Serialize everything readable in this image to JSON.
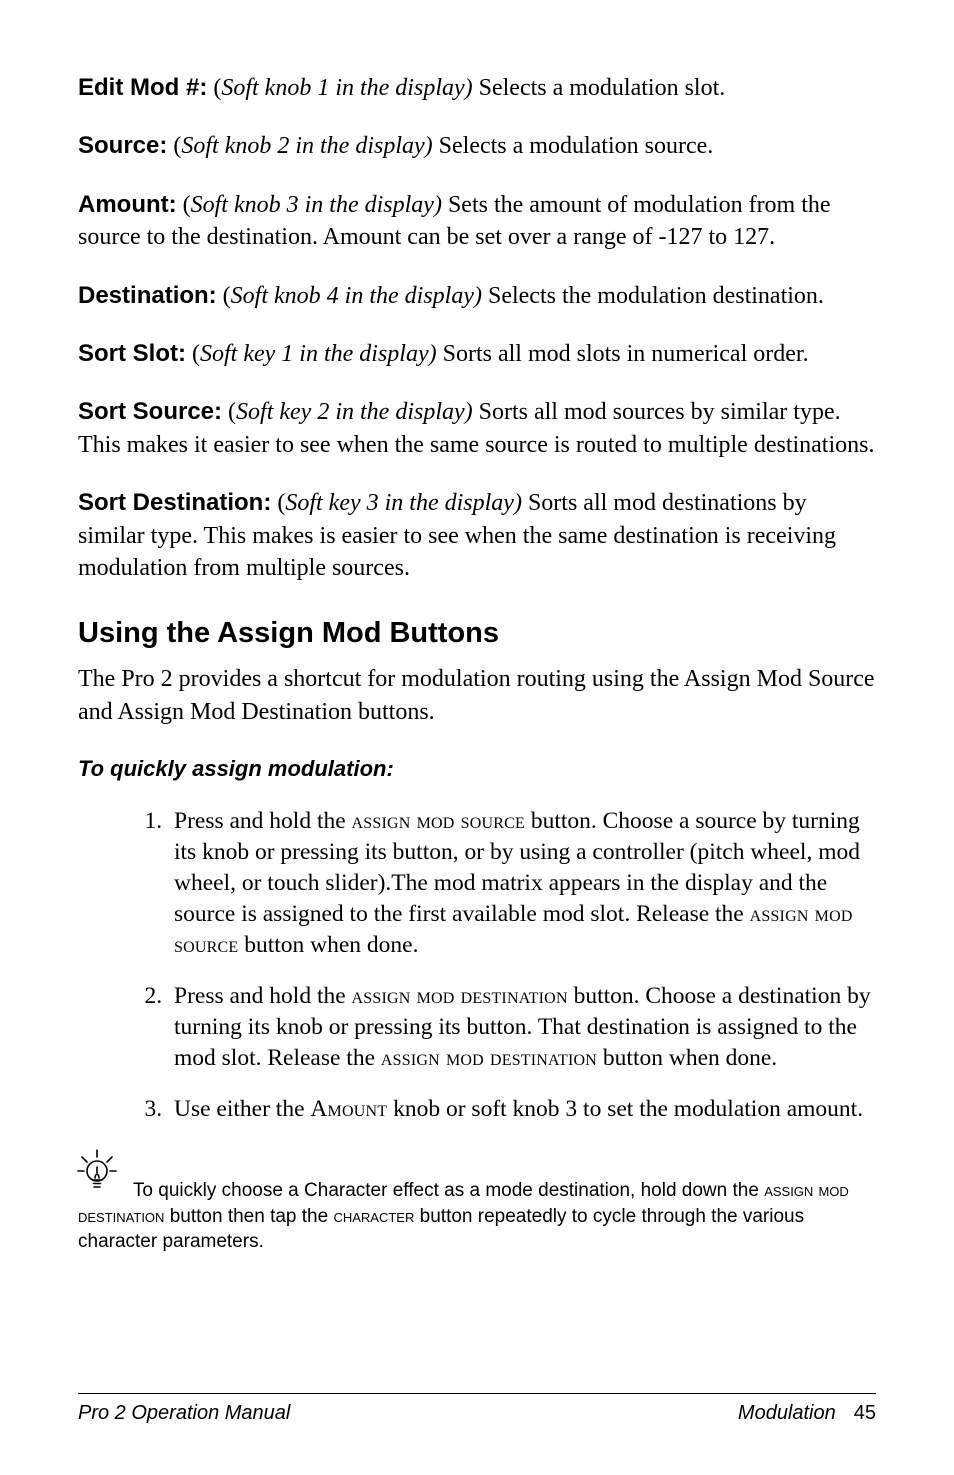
{
  "p1": {
    "label": "Edit Mod #:",
    "hint": "Soft knob 1 in the display)",
    "rest": " Selects a modulation slot."
  },
  "p2": {
    "label": "Source:",
    "hint": "Soft knob 2 in the display)",
    "rest": " Selects a modulation source."
  },
  "p3": {
    "label": "Amount:",
    "hint": "Soft knob 3 in the display)",
    "rest": " Sets the amount of modulation from the source to the destination. Amount can be set over a range of -127 to 127."
  },
  "p4": {
    "label": "Destination:",
    "hint": "Soft knob 4 in the display)",
    "rest": " Selects the modulation destination."
  },
  "p5": {
    "label": "Sort Slot:",
    "hint": "Soft key 1 in the display)",
    "rest": " Sorts all mod slots in numerical order."
  },
  "p6": {
    "label": "Sort Source:",
    "hint": "Soft key 2 in the display)",
    "rest": " Sorts all mod sources by similar type. This makes it easier to see when the same source is routed to multiple destinations."
  },
  "p7": {
    "label": "Sort Destination:",
    "hint": "Soft key 3 in the display)",
    "rest": " Sorts all mod destinations by similar type. This makes is easier to see when the same destination is receiving modulation from multiple sources."
  },
  "section_title": "Using the Assign Mod Buttons",
  "section_body": "The Pro 2 provides a shortcut for modulation routing using the Assign Mod Source and Assign Mod Destination buttons.",
  "subhead": "To quickly assign modulation:",
  "step1": {
    "a": "Press and hold the ",
    "sc1": "assign mod source",
    "b": " button. Choose a source by turning its knob or pressing its button, or by using a controller (pitch wheel, mod wheel, or touch slider).The mod matrix appears in the display and the source is assigned to the first available mod slot. Release the ",
    "sc2": "assign mod source",
    "c": " button when done."
  },
  "step2": {
    "a": "Press and hold the ",
    "sc1": "assign mod destination",
    "b": " button. Choose a destination by turning its knob or pressing its button. That destination is assigned to the mod slot. Release the ",
    "sc2": "assign mod destination",
    "c": " button when done."
  },
  "step3": {
    "a": "Use either the ",
    "sc1": "Amount",
    "b": " knob or soft knob 3 to set the modulation amount."
  },
  "tip": {
    "a": " To quickly choose a Character effect as a mode destination, hold down the ",
    "sc1": "assign mod destination",
    "b": " button then tap the ",
    "sc2": "character",
    "c": " button repeatedly to cycle through the various character parameters."
  },
  "footer": {
    "left": "Pro 2 Operation Manual",
    "right_label": "Modulation",
    "page": "45"
  }
}
